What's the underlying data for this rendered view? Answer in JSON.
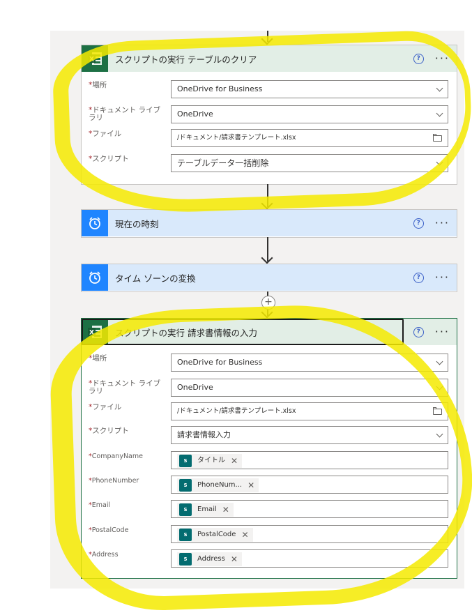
{
  "cards": {
    "clear": {
      "title": "スクリプトの実行 テーブルのクリア",
      "fields": {
        "location": {
          "label": "場所",
          "value": "OneDrive for Business"
        },
        "library": {
          "label": "ドキュメント ライブラリ",
          "value": "OneDrive"
        },
        "file": {
          "label": "ファイル",
          "value": "/ドキュメント/請求書テンプレート.xlsx"
        },
        "script": {
          "label": "スクリプト",
          "value": "テーブルデータ一括削除"
        }
      }
    },
    "now": {
      "title": "現在の時刻"
    },
    "tz": {
      "title": "タイム ゾーンの変換"
    },
    "input": {
      "title": "スクリプトの実行 請求書情報の入力",
      "fields": {
        "location": {
          "label": "場所",
          "value": "OneDrive for Business"
        },
        "library": {
          "label": "ドキュメント ライブラリ",
          "value": "OneDrive"
        },
        "file": {
          "label": "ファイル",
          "value": "/ドキュメント/請求書テンプレート.xlsx"
        },
        "script": {
          "label": "スクリプト",
          "value": "請求書情報入力"
        },
        "company": {
          "label": "CompanyName",
          "token": "タイトル"
        },
        "phone": {
          "label": "PhoneNumber",
          "token": "PhoneNum..."
        },
        "email": {
          "label": "Email",
          "token": "Email"
        },
        "postal": {
          "label": "PostalCode",
          "token": "PostalCode"
        },
        "address": {
          "label": "Address",
          "token": "Address"
        }
      }
    }
  },
  "common": {
    "required_mark": "*",
    "help_glyph": "?",
    "more_glyph": "···",
    "plus_glyph": "+",
    "remove_glyph": "✕",
    "sp_glyph": "S"
  },
  "colors": {
    "excel": "#1d7044",
    "clock": "#1f85ff",
    "highlight": "#f5ea00"
  }
}
